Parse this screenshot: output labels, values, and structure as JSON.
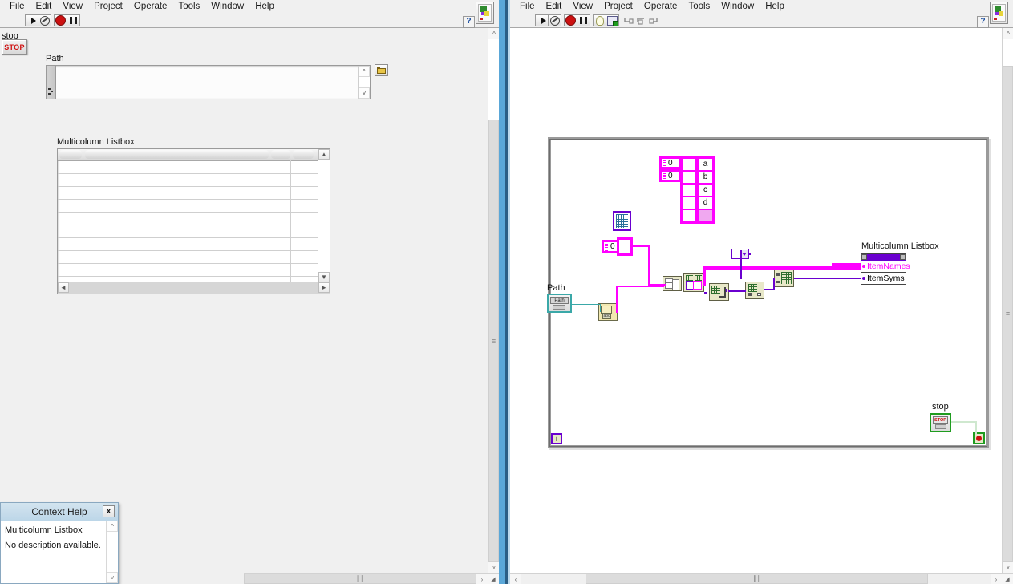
{
  "front_panel": {
    "menu": [
      "File",
      "Edit",
      "View",
      "Project",
      "Operate",
      "Tools",
      "Window",
      "Help"
    ],
    "toolbar": {
      "run_icon": "run-arrow-icon",
      "run_continuous_icon": "run-continuously-icon",
      "abort_icon": "abort-execution-icon",
      "pause_icon": "pause-icon",
      "help_label": "?"
    },
    "stop_label": "stop",
    "stop_button_text": "STOP",
    "path_label": "Path",
    "path_value": "",
    "browse_icon": "folder-browse-icon",
    "listbox_label": "Multicolumn Listbox",
    "listbox_columns": [
      "",
      "",
      "",
      ""
    ],
    "listbox_rows": [
      [
        "",
        "",
        "",
        ""
      ],
      [
        "",
        "",
        "",
        ""
      ],
      [
        "",
        "",
        "",
        ""
      ],
      [
        "",
        "",
        "",
        ""
      ],
      [
        "",
        "",
        "",
        ""
      ],
      [
        "",
        "",
        "",
        ""
      ],
      [
        "",
        "",
        "",
        ""
      ],
      [
        "",
        "",
        "",
        ""
      ]
    ]
  },
  "context_help": {
    "title": "Context Help",
    "close_label": "x",
    "lines": [
      "Multicolumn Listbox",
      "No description available."
    ]
  },
  "block_diagram": {
    "menu": [
      "File",
      "Edit",
      "View",
      "Project",
      "Operate",
      "Tools",
      "Window",
      "Help"
    ],
    "toolbar": {
      "run_icon": "run-arrow-icon",
      "run_continuous_icon": "run-continuously-icon",
      "abort_icon": "abort-execution-icon",
      "pause_icon": "pause-icon",
      "highlight_icon": "highlight-execution-bulb-icon",
      "retain_wire_icon": "retain-wire-values-icon",
      "step_into_icon": "step-into-icon",
      "step_over_icon": "step-over-icon",
      "step_out_icon": "step-out-icon",
      "help_label": "?"
    },
    "array_constant": {
      "index_values": [
        "0",
        "0"
      ],
      "cells": [
        [
          "",
          "a"
        ],
        [
          "",
          "b"
        ],
        [
          "",
          "c"
        ],
        [
          "",
          "d"
        ],
        [
          "",
          ""
        ]
      ]
    },
    "numeric_constant": "0",
    "path_terminal_label": "Path",
    "path_terminal_text": "Path",
    "property_node": {
      "reference_label": "Multicolumn Listbox",
      "properties": [
        {
          "name": "ItemNames",
          "selected": true
        },
        {
          "name": "ItemSyms",
          "selected": false
        }
      ]
    },
    "stop_terminal_label": "stop",
    "stop_terminal_text": "STOP",
    "iteration_terminal": "i"
  },
  "colors": {
    "wire_string_array": "#ff00ff",
    "wire_refnum": "#6a00cf",
    "wire_path": "#3aa8a8",
    "wire_boolean": "#cfe8cf",
    "window_accent": "#5aa7d8",
    "help_titlebar": "#bcd6e8",
    "stop_red": "#d01010",
    "loop_border": "#9a9a9a"
  }
}
